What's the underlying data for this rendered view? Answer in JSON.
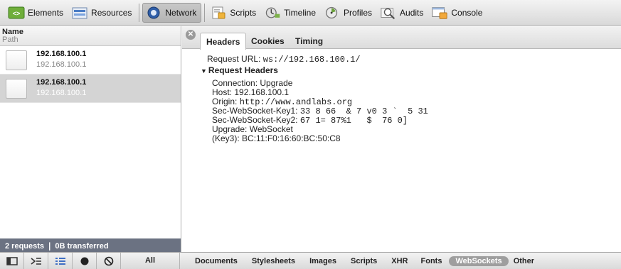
{
  "toolbar": {
    "items": [
      {
        "label": "Elements",
        "icon": "elements-icon"
      },
      {
        "label": "Resources",
        "icon": "resources-icon"
      },
      {
        "label": "Network",
        "icon": "network-icon",
        "active": true
      },
      {
        "label": "Scripts",
        "icon": "scripts-icon"
      },
      {
        "label": "Timeline",
        "icon": "timeline-icon"
      },
      {
        "label": "Profiles",
        "icon": "profiles-icon"
      },
      {
        "label": "Audits",
        "icon": "audits-icon"
      },
      {
        "label": "Console",
        "icon": "console-icon"
      }
    ]
  },
  "request_list": {
    "header_name": "Name",
    "header_path": "Path",
    "requests": [
      {
        "name": "192.168.100.1",
        "path": "192.168.100.1"
      },
      {
        "name": "192.168.100.1",
        "path": "192.168.100.1"
      }
    ],
    "footer": "2 requests ❘ 0B transferred"
  },
  "detail": {
    "close_symbol": "✕",
    "tabs": [
      "Headers",
      "Cookies",
      "Timing"
    ],
    "request_url_label": "Request URL:",
    "request_url_value": "ws://192.168.100.1/",
    "request_headers_title": "Request Headers",
    "headers": [
      {
        "key": "Connection:",
        "value": "Upgrade"
      },
      {
        "key": "Host:",
        "value": "192.168.100.1"
      },
      {
        "key": "Origin:",
        "value": "http://www.andlabs.org"
      },
      {
        "key": "Sec-WebSocket-Key1:",
        "value": "33 8 66  & 7 v0 3 `  5 31"
      },
      {
        "key": "Sec-WebSocket-Key2:",
        "value": "67 1= 87%1   $  76 0]"
      },
      {
        "key": "Upgrade:",
        "value": "WebSocket"
      },
      {
        "key": "(Key3):",
        "value": "BC:11:F0:16:60:BC:50:C8"
      }
    ]
  },
  "bottom_bar": {
    "all_label": "All",
    "filters": [
      "Documents",
      "Stylesheets",
      "Images",
      "Scripts",
      "XHR",
      "Fonts",
      "WebSockets",
      "Other"
    ],
    "active_filter": "WebSockets"
  }
}
